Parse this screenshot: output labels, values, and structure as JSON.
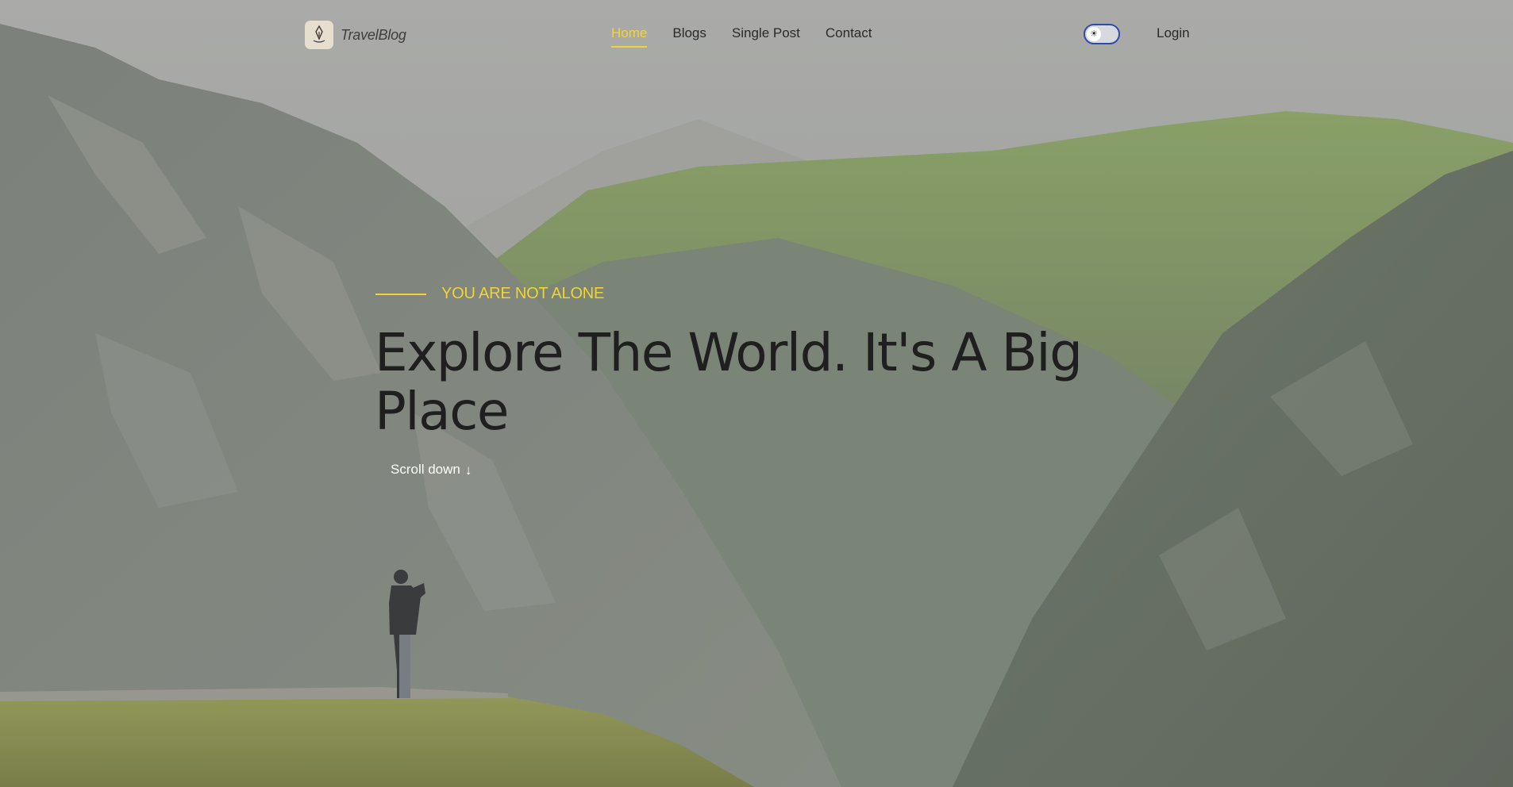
{
  "brand": {
    "name": "TravelBlog",
    "logo_icon": "pen-nib-logo-icon"
  },
  "nav": {
    "items": [
      {
        "label": "Home",
        "active": true
      },
      {
        "label": "Blogs",
        "active": false
      },
      {
        "label": "Single Post",
        "active": false
      },
      {
        "label": "Contact",
        "active": false
      }
    ]
  },
  "theme_toggle": {
    "icon": "sun-icon",
    "glyph": "☀",
    "state": "light"
  },
  "login_label": "Login",
  "hero": {
    "eyebrow": "YOU ARE NOT ALONE",
    "headline": "Explore The World. It's A Big Place",
    "scroll_label": "Scroll down",
    "scroll_icon": "arrow-down-icon",
    "scroll_glyph": "↓"
  },
  "colors": {
    "accent": "#f2d336",
    "text_dark": "#1f1f1f",
    "toggle_border": "#2f4da8"
  }
}
